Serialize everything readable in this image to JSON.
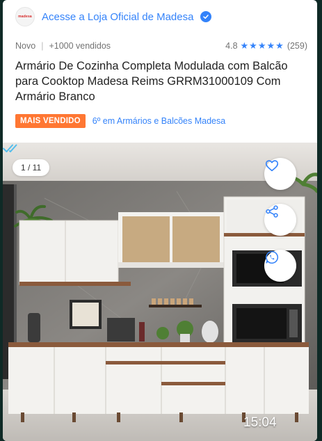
{
  "store": {
    "logo_text": "madesa",
    "link_label": "Acesse a Loja Oficial de Madesa",
    "verified_icon": "verified-check-icon"
  },
  "meta": {
    "condition": "Novo",
    "separator": "|",
    "sold": "+1000 vendidos",
    "rating_value": "4.8",
    "stars": "★★★★★",
    "review_count": "(259)"
  },
  "product": {
    "title": "Armário De Cozinha Completa Modulada com Balcão para Cooktop Madesa Reims GRRM31000109 Com Armário Branco"
  },
  "badge": {
    "label": "MAIS VENDIDO",
    "rank_text": "6º em Armários e Balcões Madesa"
  },
  "gallery": {
    "counter": "1 / 11",
    "actions": [
      "heart-icon",
      "share-icon",
      "whatsapp-icon"
    ]
  },
  "message": {
    "time": "15:04",
    "status_icon": "double-check-icon"
  },
  "colors": {
    "link": "#3483fa",
    "badge": "#ff7733",
    "whatsapp_bubble": "#0f2a26"
  }
}
